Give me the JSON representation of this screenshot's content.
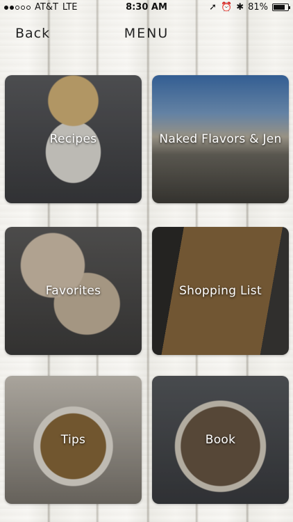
{
  "status": {
    "carrier": "AT&T",
    "network": "LTE",
    "time": "8:30 AM",
    "battery": "81%",
    "battery_level": 0.81
  },
  "nav": {
    "back_label": "Back",
    "title": "MENU"
  },
  "tiles": [
    {
      "label": "Recipes"
    },
    {
      "label": "Naked Flavors & Jen"
    },
    {
      "label": "Favorites"
    },
    {
      "label": "Shopping List"
    },
    {
      "label": "Tips"
    },
    {
      "label": "Book"
    }
  ]
}
